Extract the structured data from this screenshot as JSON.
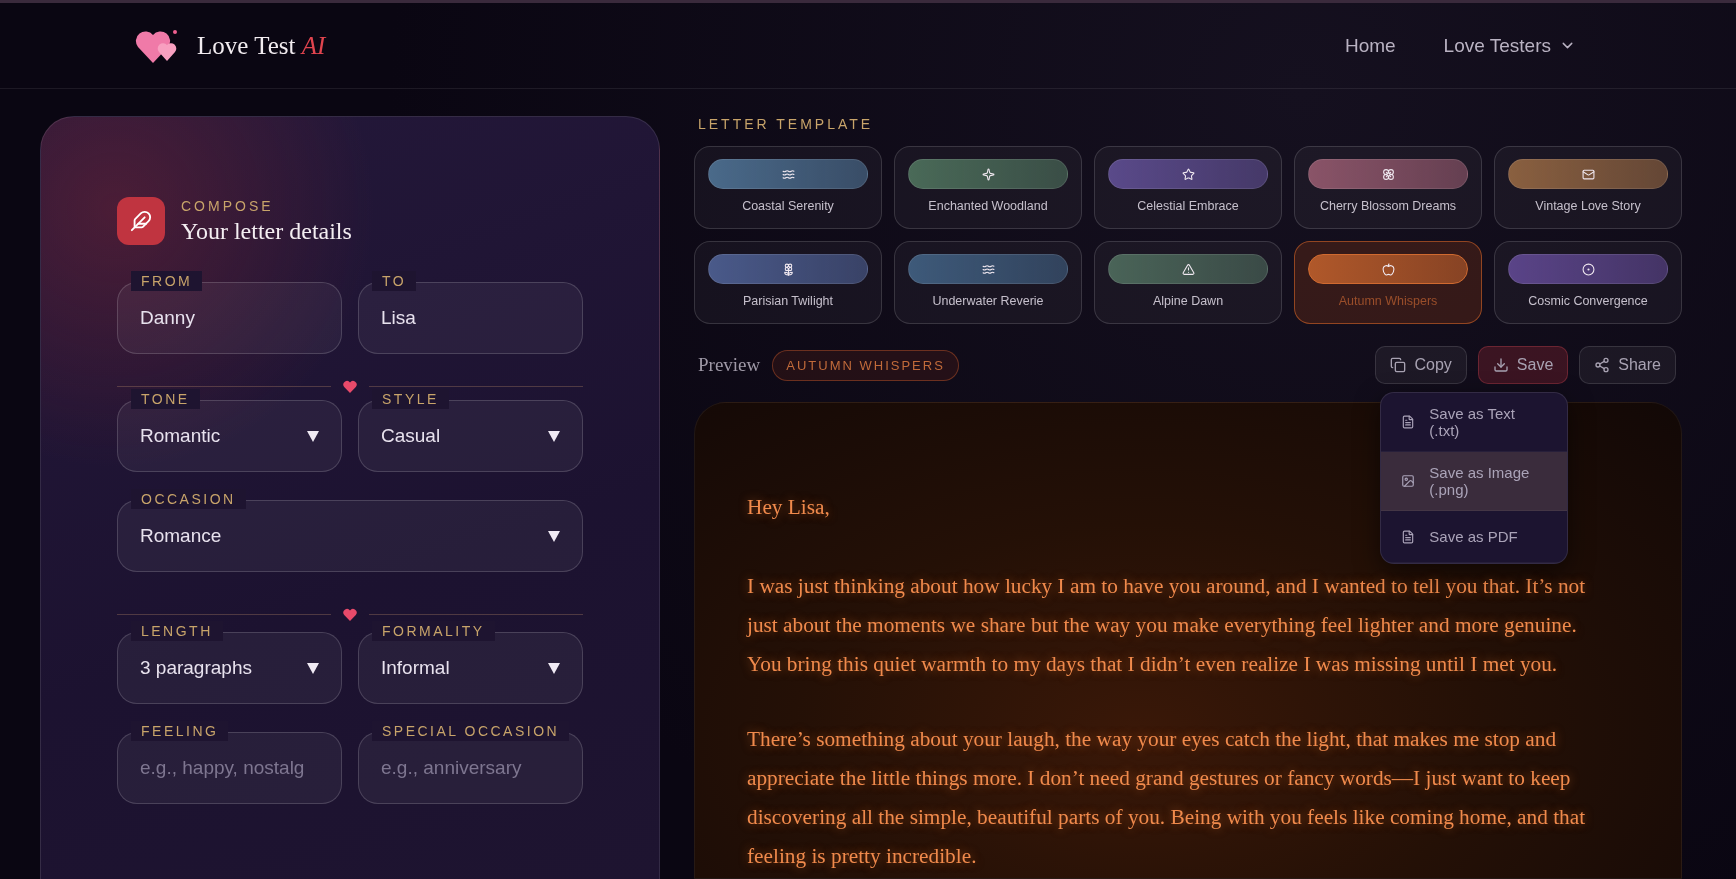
{
  "header": {
    "brand": "Love Test",
    "brand_accent": "AI",
    "nav": [
      {
        "label": "Home",
        "kind": "link"
      },
      {
        "label": "Love Testers",
        "kind": "dropdown"
      }
    ]
  },
  "compose": {
    "eyebrow": "COMPOSE",
    "title": "Your letter details",
    "sections": [
      {
        "rows": [
          [
            {
              "label": "FROM",
              "kind": "input",
              "value": "Danny"
            },
            {
              "label": "TO",
              "kind": "input",
              "value": "Lisa"
            }
          ]
        ]
      },
      {
        "rows": [
          [
            {
              "label": "TONE",
              "kind": "select",
              "value": "Romantic"
            },
            {
              "label": "STYLE",
              "kind": "select",
              "value": "Casual"
            }
          ],
          [
            {
              "label": "OCCASION",
              "kind": "select",
              "value": "Romance"
            }
          ]
        ]
      },
      {
        "rows": [
          [
            {
              "label": "LENGTH",
              "kind": "select",
              "value": "3 paragraphs"
            },
            {
              "label": "FORMALITY",
              "kind": "select",
              "value": "Informal"
            }
          ],
          [
            {
              "label": "FEELING",
              "kind": "input",
              "placeholder": "e.g., happy, nostalg"
            },
            {
              "label": "SPECIAL OCCASION",
              "kind": "input",
              "placeholder": "e.g., anniversary"
            }
          ]
        ]
      }
    ]
  },
  "templates": {
    "heading": "LETTER TEMPLATE",
    "items": [
      {
        "name": "Coastal Serenity",
        "color": "#4a6a8a",
        "selected": false
      },
      {
        "name": "Enchanted Woodland",
        "color": "#4a6a58",
        "selected": false
      },
      {
        "name": "Celestial Embrace",
        "color": "#5a4a8a",
        "selected": false
      },
      {
        "name": "Cherry Blossom Dreams",
        "color": "#8a5468",
        "selected": false
      },
      {
        "name": "Vintage Love Story",
        "color": "#8a6040",
        "selected": false
      },
      {
        "name": "Parisian Twilight",
        "color": "#4a5a8a",
        "selected": false
      },
      {
        "name": "Underwater Reverie",
        "color": "#3e5a7a",
        "selected": false
      },
      {
        "name": "Alpine Dawn",
        "color": "#4a6458",
        "selected": false
      },
      {
        "name": "Autumn Whispers",
        "color": "#b0582a",
        "selected": true
      },
      {
        "name": "Cosmic Convergence",
        "color": "#5a4488",
        "selected": false
      }
    ]
  },
  "preview": {
    "label": "Preview",
    "badge": "AUTUMN WHISPERS",
    "actions": [
      {
        "label": "Copy",
        "selected": false
      },
      {
        "label": "Save",
        "selected": true
      },
      {
        "label": "Share",
        "selected": false
      }
    ],
    "save_menu": [
      {
        "label": "Save as Text (.txt)",
        "selected": false
      },
      {
        "label": "Save as Image (.png)",
        "selected": true
      },
      {
        "label": "Save as PDF",
        "selected": false
      }
    ],
    "letter": {
      "greeting": "Hey Lisa,",
      "paragraphs": [
        "I was just thinking about how lucky I am to have you around, and I wanted to tell you that. It’s not just about the moments we share but the way you make everything feel lighter and more genuine. You bring this quiet warmth to my days that I didn’t even realize I was missing until I met you.",
        "There’s something about your laugh, the way your eyes catch the light, that makes me stop and appreciate the little things more. I don’t need grand gestures or fancy words—I just want to keep discovering all the simple, beautiful parts of you. Being with you feels like coming home, and that feeling is pretty incredible."
      ]
    }
  }
}
